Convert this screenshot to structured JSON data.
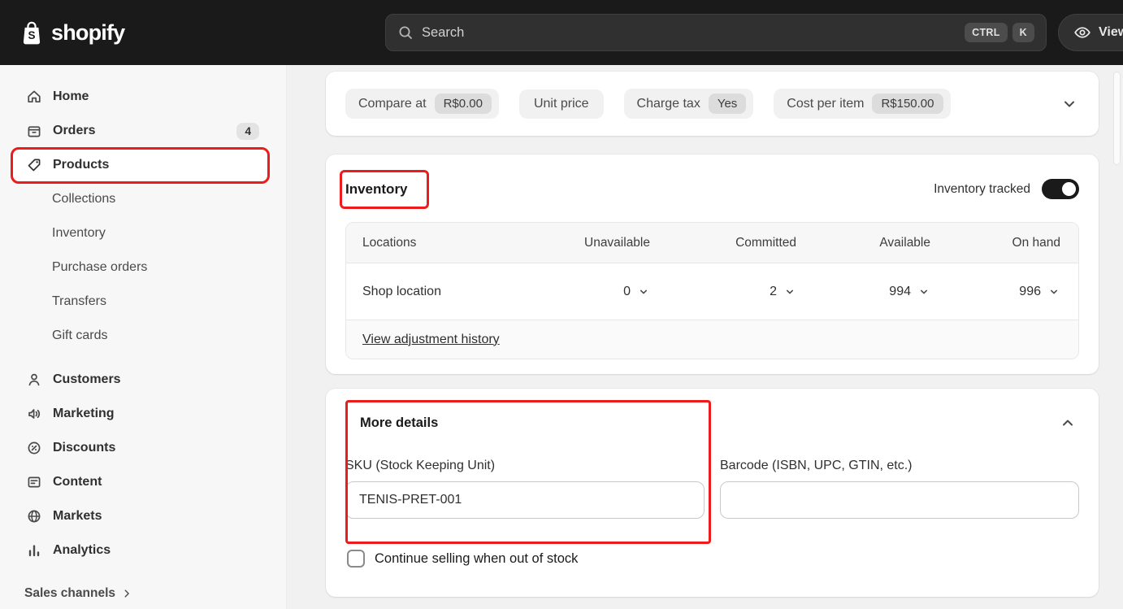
{
  "topbar": {
    "brand": "shopify",
    "brand_initial": "S",
    "search": {
      "placeholder": "Search",
      "shortcut_keys": [
        "CTRL",
        "K"
      ]
    },
    "view_label": "View"
  },
  "sidebar": {
    "items": [
      {
        "label": "Home"
      },
      {
        "label": "Orders",
        "badge": "4"
      },
      {
        "label": "Products"
      },
      {
        "label": "Customers"
      },
      {
        "label": "Marketing"
      },
      {
        "label": "Discounts"
      },
      {
        "label": "Content"
      },
      {
        "label": "Markets"
      },
      {
        "label": "Analytics"
      }
    ],
    "sub_items": [
      "Collections",
      "Inventory",
      "Purchase orders",
      "Transfers",
      "Gift cards"
    ],
    "footer_label": "Sales channels"
  },
  "pricing": {
    "chips": [
      {
        "label": "Compare at",
        "value": "R$0.00"
      },
      {
        "label": "Unit price",
        "value": ""
      },
      {
        "label": "Charge tax",
        "value": "Yes"
      },
      {
        "label": "Cost per item",
        "value": "R$150.00"
      }
    ]
  },
  "inventory": {
    "title": "Inventory",
    "tracked_label": "Inventory tracked",
    "tracked_on": true,
    "columns": [
      "Locations",
      "Unavailable",
      "Committed",
      "Available",
      "On hand"
    ],
    "row": {
      "location": "Shop location",
      "unavailable": "0",
      "committed": "2",
      "available": "994",
      "on_hand": "996"
    },
    "history_link": "View adjustment history"
  },
  "more_details": {
    "title": "More details",
    "sku_label": "SKU (Stock Keeping Unit)",
    "sku_value": "TENIS-PRET-001",
    "barcode_label": "Barcode (ISBN, UPC, GTIN, etc.)",
    "barcode_value": "",
    "continue_selling_label": "Continue selling when out of stock",
    "continue_selling_checked": false
  }
}
